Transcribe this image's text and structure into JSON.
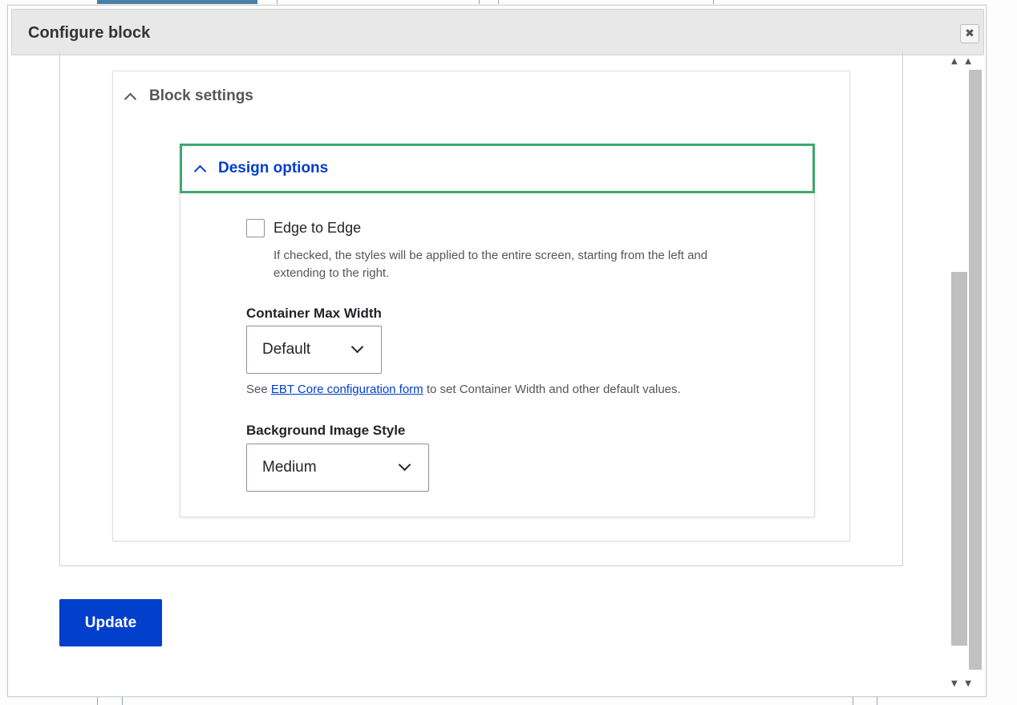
{
  "dialog": {
    "title": "Configure block",
    "close_icon": "close-icon"
  },
  "block_settings": {
    "title": "Block settings",
    "expanded": true
  },
  "design_options": {
    "title": "Design options",
    "expanded": true,
    "edge_to_edge": {
      "label": "Edge to Edge",
      "checked": false,
      "description": "If checked, the styles will be applied to the entire screen, starting from the left and extending to the right."
    },
    "container_max_width": {
      "label": "Container Max Width",
      "value": "Default",
      "help_prefix": "See ",
      "help_link": "EBT Core configuration form",
      "help_suffix": " to set Container Width and other default values."
    },
    "background_image_style": {
      "label": "Background Image Style",
      "value": "Medium"
    }
  },
  "actions": {
    "update_label": "Update"
  },
  "colors": {
    "primary": "#003ecc",
    "focus_border": "#3fa86d",
    "titlebar": "#e8e8e8"
  }
}
